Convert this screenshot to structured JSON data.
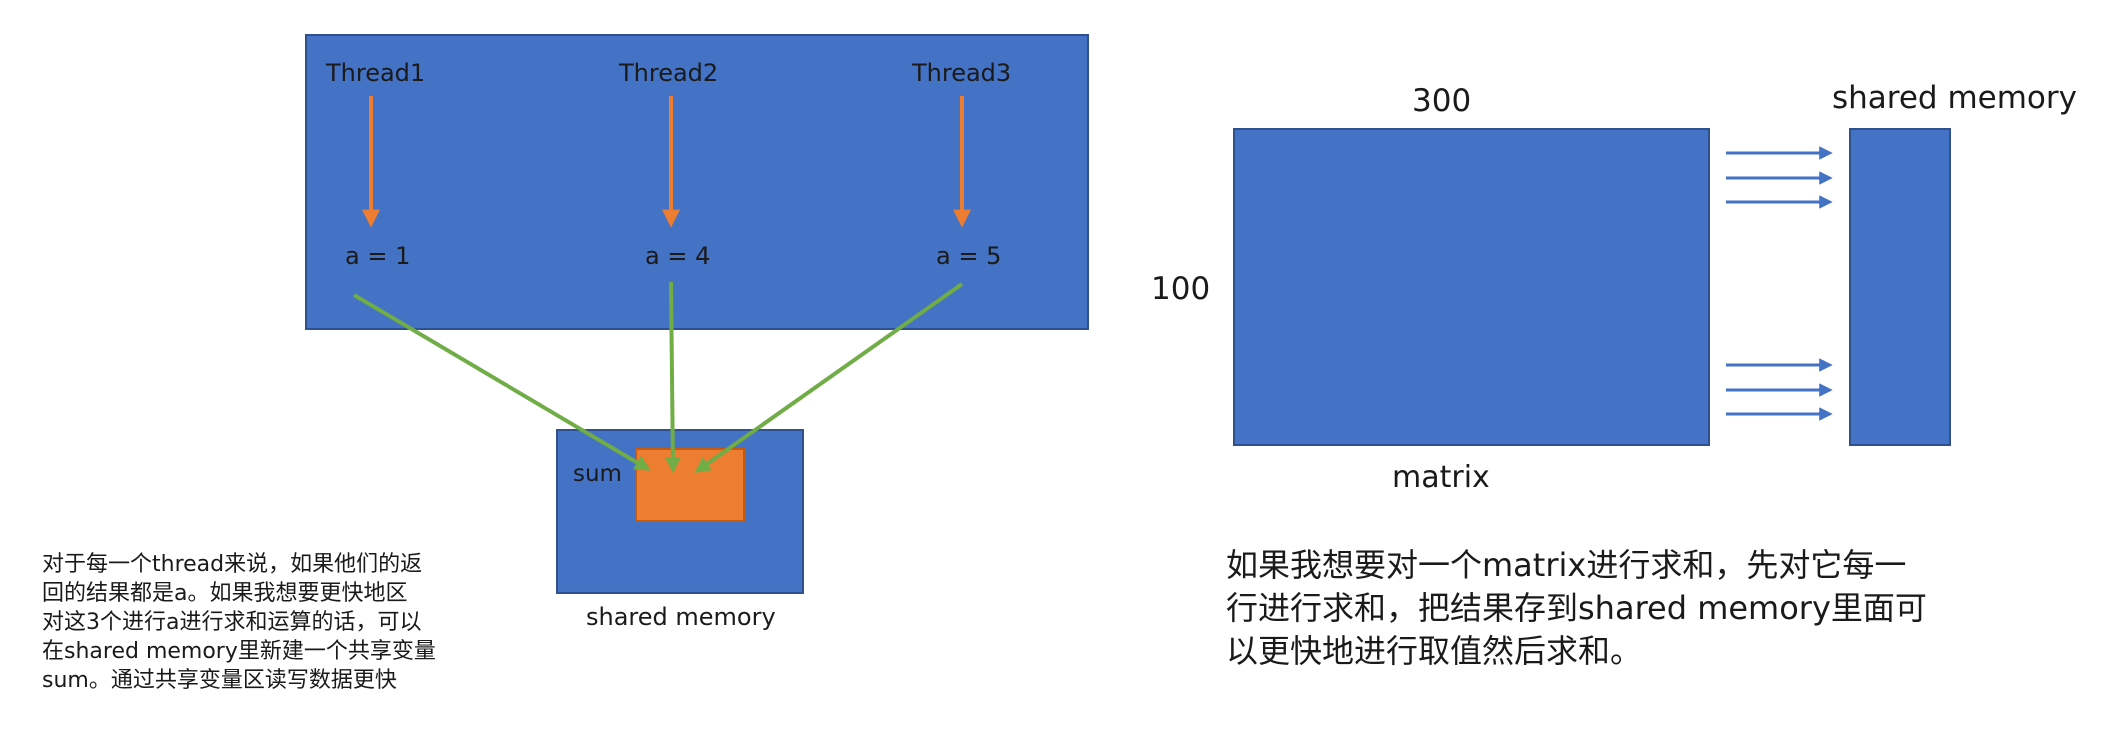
{
  "left_diagram": {
    "threads": [
      {
        "label": "Thread1",
        "value_label": "a = 1"
      },
      {
        "label": "Thread2",
        "value_label": "a = 4"
      },
      {
        "label": "Thread3",
        "value_label": "a = 5"
      }
    ],
    "sum_label": "sum",
    "shared_memory_label": "shared memory",
    "description_lines": [
      "对于每一个thread来说，如果他们的返",
      "回的结果都是a。如果我想要更快地区",
      "对这3个进行a进行求和运算的话，可以",
      "在shared memory里新建一个共享变量",
      "sum。通过共享变量区读写数据更快"
    ]
  },
  "right_diagram": {
    "matrix_width_label": "300",
    "matrix_height_label": "100",
    "matrix_label": "matrix",
    "shared_memory_label": "shared memory",
    "description_lines": [
      "如果我想要对一个matrix进行求和，先对它每一",
      "行进行求和，把结果存到shared memory里面可",
      "以更快地进行取值然后求和。"
    ]
  },
  "colors": {
    "block_fill": "#4472c4",
    "block_stroke": "#2f528f",
    "accent_orange": "#ed7d31",
    "arrow_green": "#70ad47",
    "arrow_blue": "#4472c4",
    "text": "#1a1a1a"
  }
}
